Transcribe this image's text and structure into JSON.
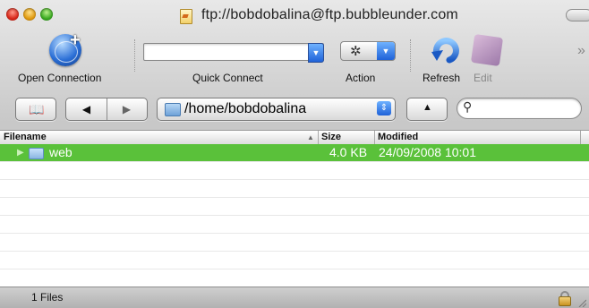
{
  "window": {
    "title": "ftp://bobdobalina@ftp.bubbleunder.com"
  },
  "toolbar": {
    "open_connection_label": "Open Connection",
    "quick_connect_label": "Quick Connect",
    "quick_connect_value": "",
    "action_label": "Action",
    "refresh_label": "Refresh",
    "edit_label": "Edit"
  },
  "navigation": {
    "path": "/home/bobdobalina",
    "search_value": ""
  },
  "table": {
    "columns": {
      "filename": "Filename",
      "size": "Size",
      "modified": "Modified"
    },
    "rows": [
      {
        "name": "web",
        "size": "4.0 KB",
        "modified": "24/09/2008 10:01",
        "selected": true,
        "type": "folder"
      }
    ]
  },
  "status": {
    "text": "1 Files"
  },
  "colors": {
    "selection": "#5ac13a",
    "accent_blue": "#1f62d8"
  },
  "icons": {
    "open_connection": "globe-plus-icon",
    "action": "gear-icon",
    "refresh": "refresh-icon",
    "edit": "edit-icon",
    "bookmarks": "book-icon",
    "back": "back-arrow-icon",
    "forward": "forward-arrow-icon",
    "up": "up-arrow-icon",
    "search": "magnifier-icon",
    "lock": "lock-icon"
  }
}
